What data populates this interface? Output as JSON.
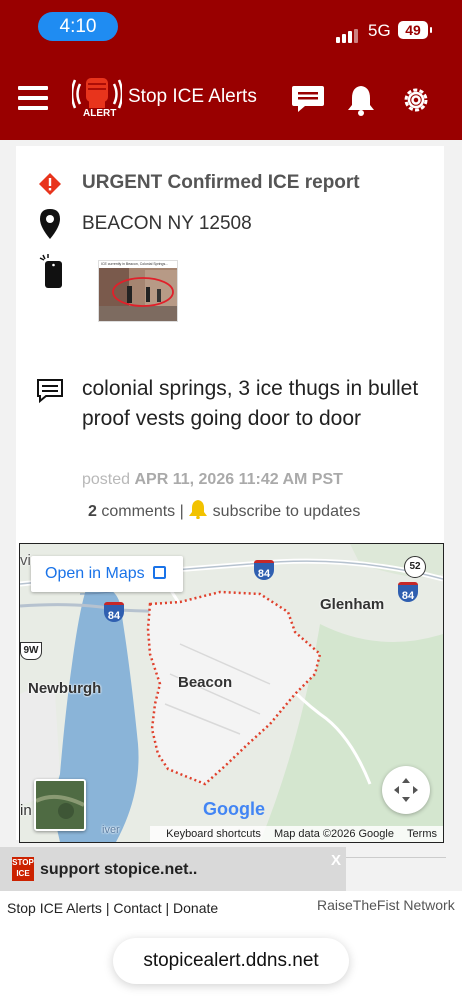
{
  "status_bar": {
    "time": "4:10",
    "network": "5G",
    "battery": "49"
  },
  "header": {
    "title": "Stop ICE Alerts",
    "logo_text": "ALERT"
  },
  "report": {
    "heading": "URGENT Confirmed ICE report",
    "location": "BEACON NY 12508",
    "thumbnail_caption": "ICE currently in Beacon, Colonial Springs...",
    "description": "colonial springs, 3 ice thugs in bullet proof vests going door to door",
    "posted_label": "posted",
    "posted_date": "APR 11, 2026 11:42 AM",
    "posted_tz": "PST",
    "comments_count": "2",
    "comments_label": "comments",
    "separator": "|",
    "subscribe_label": "subscribe to updates"
  },
  "map": {
    "open_label": "Open in Maps",
    "places": {
      "newburgh": "Newburgh",
      "beacon": "Beacon",
      "glenham": "Glenham",
      "vi": "vi",
      "in": "in",
      "river": "iver"
    },
    "shields": {
      "i84_a": "84",
      "i84_b": "84",
      "i84_c": "84",
      "r52": "52",
      "r9w": "9W"
    },
    "brand": "Google",
    "attribution": {
      "shortcuts": "Keyboard shortcuts",
      "data": "Map data ©2026 Google",
      "terms": "Terms"
    }
  },
  "support": {
    "logo": "STOP ICE",
    "text": "support stopice.net..",
    "close": "X"
  },
  "footer": {
    "link_alerts": "Stop ICE Alerts",
    "link_contact": "Contact",
    "link_donate": "Donate",
    "sep": "|",
    "network": "RaiseTheFist Network"
  },
  "browser": {
    "url": "stopicealert.ddns.net"
  },
  "colors": {
    "header_bg": "#990000",
    "alert_red": "#e8341c",
    "link_blue": "#1a73e8",
    "boundary": "#e0402c"
  }
}
